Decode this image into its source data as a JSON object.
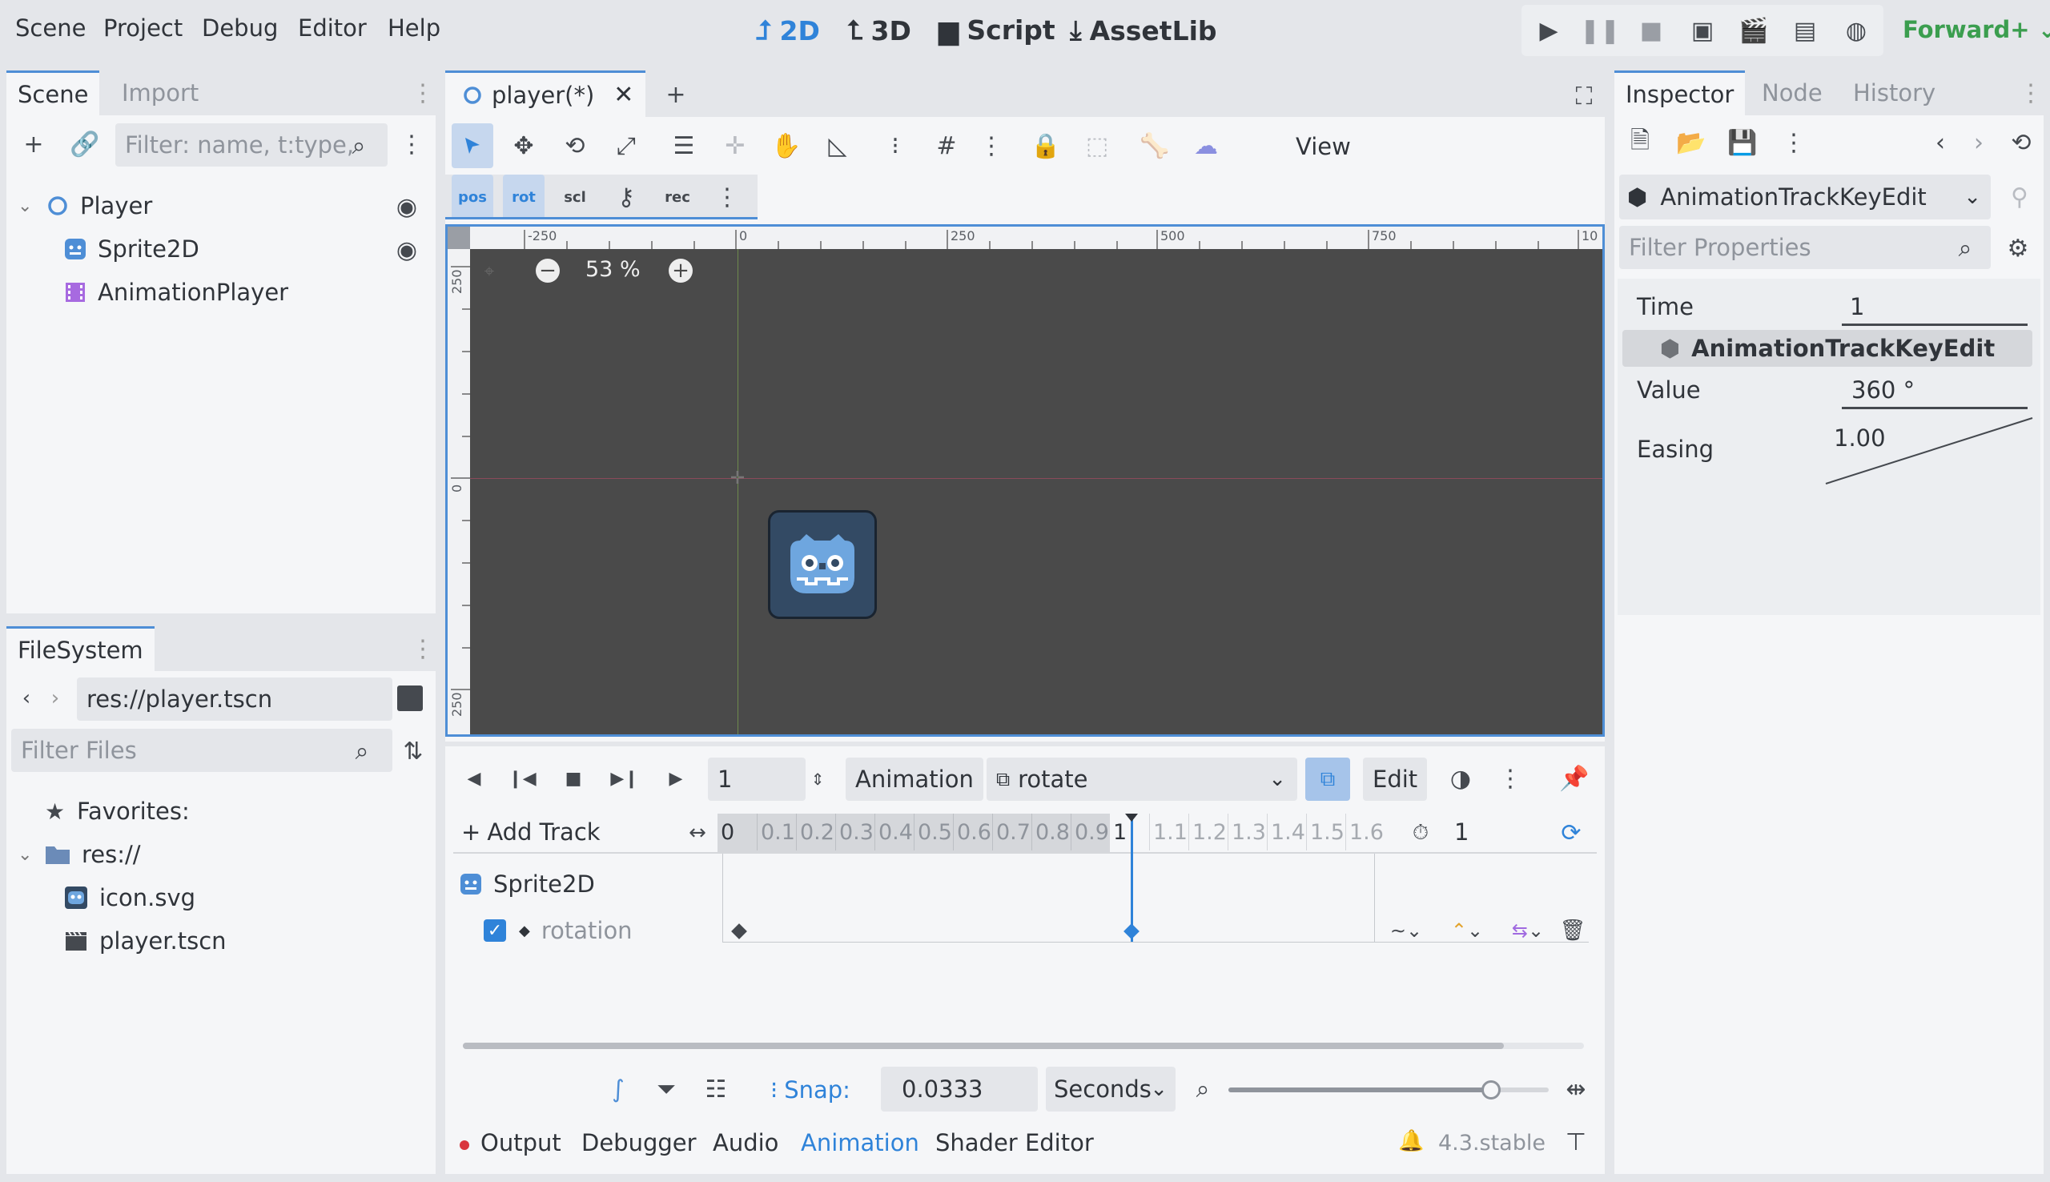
{
  "menu": {
    "scene": "Scene",
    "project": "Project",
    "debug": "Debug",
    "editor": "Editor",
    "help": "Help"
  },
  "main_tabs": {
    "t2d": "2D",
    "t3d": "3D",
    "script": "Script",
    "assetlib": "AssetLib"
  },
  "renderer": "Forward+",
  "scene_dock": {
    "tab_scene": "Scene",
    "tab_import": "Import",
    "filter_placeholder": "Filter: name, t:type,",
    "nodes": [
      "Player",
      "Sprite2D",
      "AnimationPlayer"
    ]
  },
  "filesystem_dock": {
    "tab": "FileSystem",
    "path": "res://player.tscn",
    "filter_placeholder": "Filter Files",
    "favorites": "Favorites:",
    "root": "res://",
    "files": [
      "icon.svg",
      "player.tscn"
    ]
  },
  "editor_tab": {
    "name": "player(*)"
  },
  "viewport": {
    "view_label": "View",
    "zoom": "53 %",
    "ruler_labels": [
      "-250",
      "0",
      "250",
      "500",
      "750",
      "10"
    ],
    "vruler_labels": [
      "250",
      "0",
      "250"
    ],
    "sub_toolbar": [
      "pos",
      "rot",
      "scl",
      "",
      "rec"
    ]
  },
  "animation": {
    "frame": "1",
    "anim_label": "Animation",
    "anim_name": "rotate",
    "edit_label": "Edit",
    "add_track": "Add Track",
    "timeline_labels": [
      "0",
      "0.1",
      "0.2",
      "0.3",
      "0.4",
      "0.5",
      "0.6",
      "0.7",
      "0.8",
      "0.9",
      "1",
      "1.1",
      "1.2",
      "1.3",
      "1.4",
      "1.5",
      "1.6"
    ],
    "length": "1",
    "track_node": "Sprite2D",
    "track_prop": "rotation",
    "snap_label": "Snap:",
    "snap_value": "0.0333",
    "snap_unit": "Seconds",
    "zoom_fraction": 0.82
  },
  "bottom_tabs": {
    "output": "Output",
    "debugger": "Debugger",
    "audio": "Audio",
    "animation": "Animation",
    "shader": "Shader Editor"
  },
  "version": "4.3.stable",
  "inspector": {
    "tab_inspector": "Inspector",
    "tab_node": "Node",
    "tab_history": "History",
    "object": "AnimationTrackKeyEdit",
    "filter_placeholder": "Filter Properties",
    "time_label": "Time",
    "time_value": "1",
    "section": "AnimationTrackKeyEdit",
    "value_label": "Value",
    "value_value": "360 °",
    "easing_label": "Easing",
    "easing_value": "1.00"
  },
  "colors": {
    "accent": "#4e8ed6",
    "viewport": "#4a4a4a",
    "anim_tab": "#2f83d9"
  }
}
